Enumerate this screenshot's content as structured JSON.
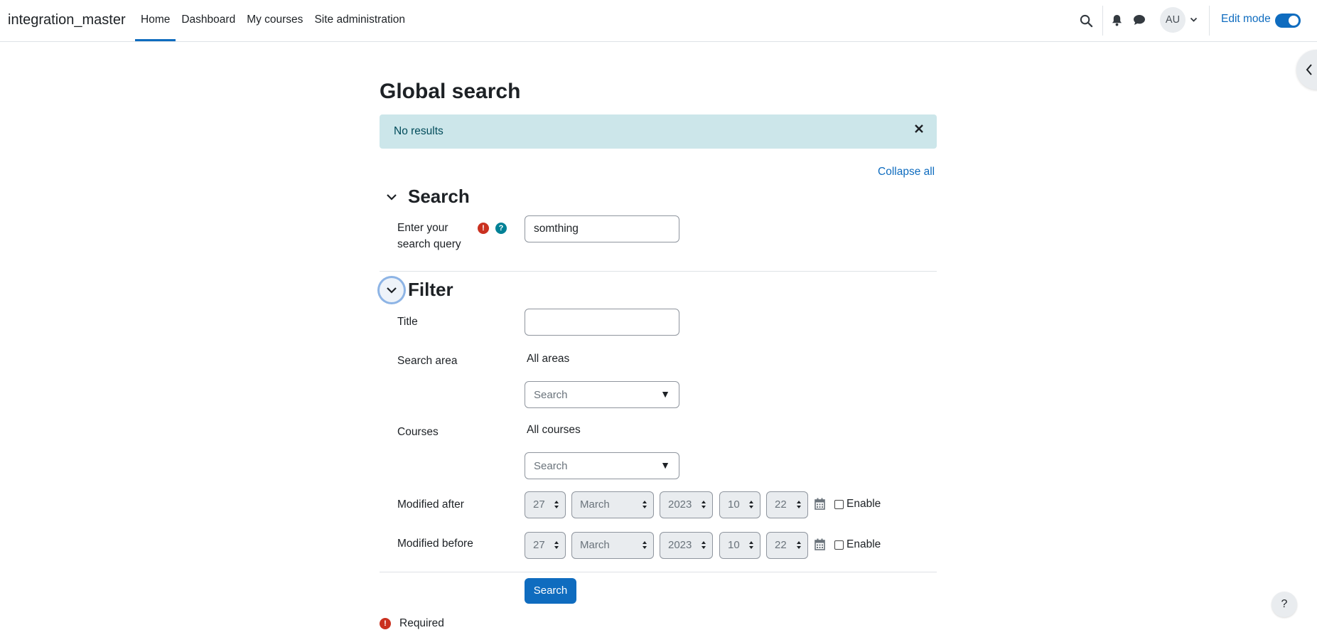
{
  "navbar": {
    "brand": "integration_master",
    "links": [
      {
        "label": "Home",
        "active": true
      },
      {
        "label": "Dashboard",
        "active": false
      },
      {
        "label": "My courses",
        "active": false
      },
      {
        "label": "Site administration",
        "active": false
      }
    ],
    "avatar_initials": "AU",
    "edit_mode_label": "Edit mode",
    "edit_mode_on": true,
    "icons": [
      "search-icon",
      "bell-icon",
      "chat-icon",
      "chevron-down-icon"
    ]
  },
  "page": {
    "title": "Global search",
    "alert": "No results",
    "collapse_all": "Collapse all"
  },
  "search_section": {
    "title": "Search",
    "query_label": "Enter your search query",
    "query_value": "somthing"
  },
  "filter_section": {
    "title": "Filter",
    "title_label": "Title",
    "title_value": "",
    "area_label": "Search area",
    "area_value": "All areas",
    "area_placeholder": "Search",
    "courses_label": "Courses",
    "courses_value": "All courses",
    "courses_placeholder": "Search",
    "modified_after_label": "Modified after",
    "modified_before_label": "Modified before",
    "date": {
      "day": "27",
      "month": "March",
      "year": "2023",
      "hour": "10",
      "minute": "22"
    },
    "enable_label": "Enable"
  },
  "actions": {
    "submit": "Search",
    "required_note": "Required",
    "help": "?"
  },
  "colors": {
    "primary": "#0f6cbf",
    "alert_bg": "#cce6ea",
    "required_icon": "#ca3120",
    "help_icon": "#008196"
  }
}
